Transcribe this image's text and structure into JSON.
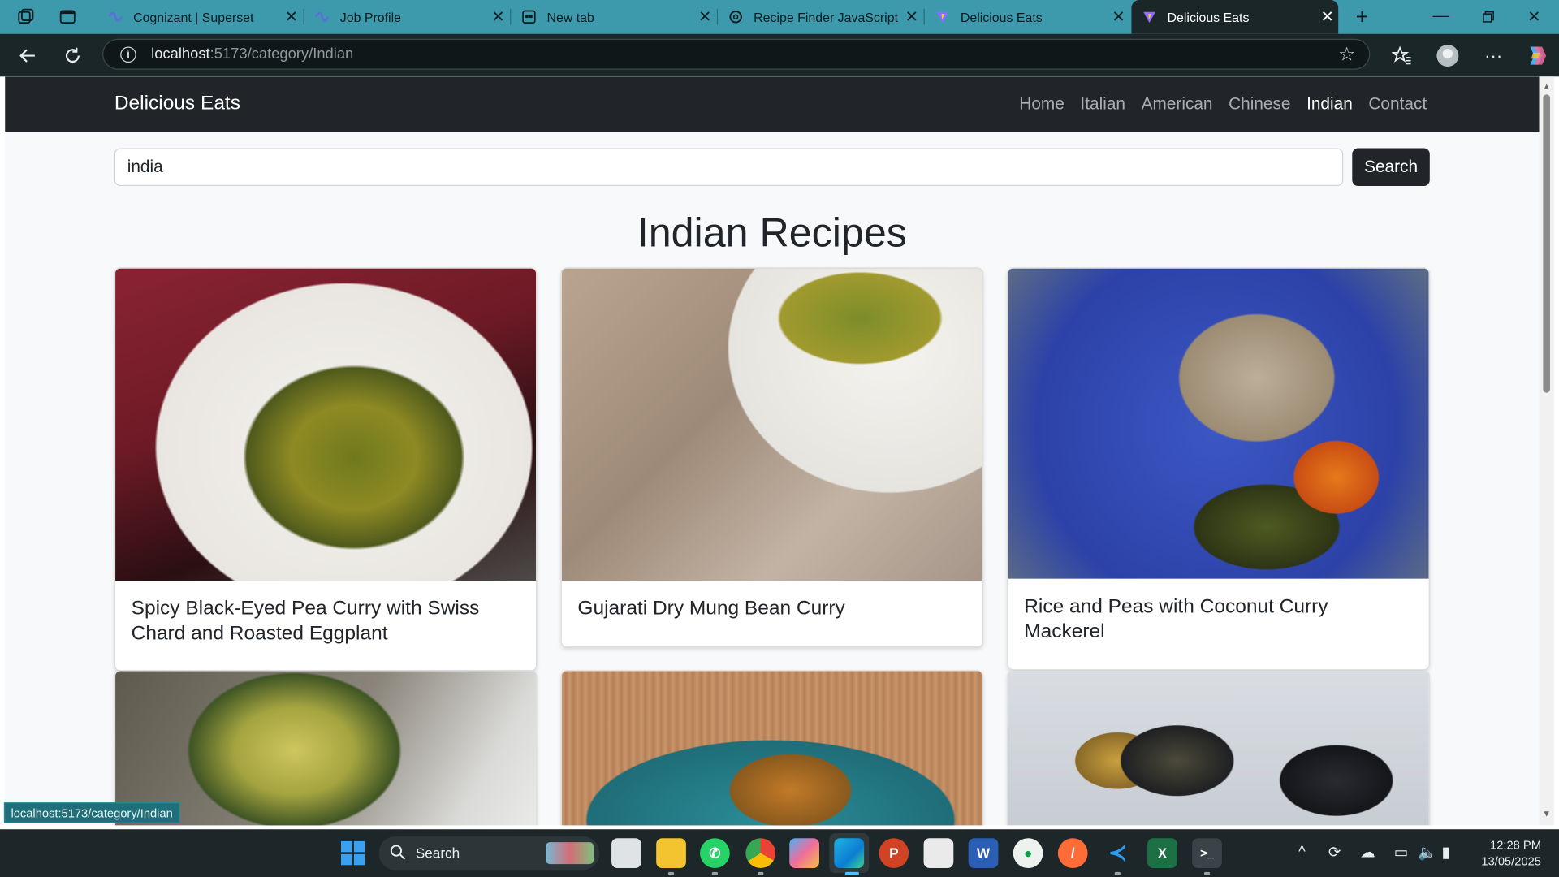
{
  "browser": {
    "tabs": [
      {
        "title": "Cognizant | Superset",
        "icon": "superset-icon"
      },
      {
        "title": "Job Profile",
        "icon": "superset-icon"
      },
      {
        "title": "New tab",
        "icon": "newtab-icon"
      },
      {
        "title": "Recipe Finder JavaScript Sk",
        "icon": "chatgpt-icon"
      },
      {
        "title": "Delicious Eats",
        "icon": "vite-icon"
      },
      {
        "title": "Delicious Eats",
        "icon": "vite-icon"
      }
    ],
    "active_tab_index": 5,
    "url_host": "localhost",
    "url_path": ":5173/category/Indian",
    "status_url": "localhost:5173/category/Indian"
  },
  "site": {
    "brand": "Delicious Eats",
    "nav": [
      "Home",
      "Italian",
      "American",
      "Chinese",
      "Indian",
      "Contact"
    ],
    "active_nav": "Indian",
    "search_value": "india",
    "search_button": "Search",
    "page_title": "Indian Recipes",
    "recipes": [
      {
        "title": "Spicy Black-Eyed Pea Curry with Swiss Chard and Roasted Eggplant"
      },
      {
        "title": "Gujarati Dry Mung Bean Curry"
      },
      {
        "title": "Rice and Peas with Coconut Curry Mackerel"
      },
      {
        "title": ""
      },
      {
        "title": ""
      },
      {
        "title": ""
      }
    ]
  },
  "taskbar": {
    "search_label": "Search",
    "apps": [
      "file-explorer-icon",
      "whatsapp-icon",
      "chrome-icon",
      "copilot-icon",
      "edge-icon",
      "powerpoint-icon",
      "store-icon",
      "word-icon",
      "mongodb-icon",
      "postman-icon",
      "vscode-icon",
      "excel-icon",
      "terminal-icon"
    ],
    "time": "12:28 PM",
    "date": "13/05/2025"
  },
  "colors": {
    "tabbar": "#3d9aac",
    "navbar": "#212529",
    "taskbar": "#1d2628"
  }
}
